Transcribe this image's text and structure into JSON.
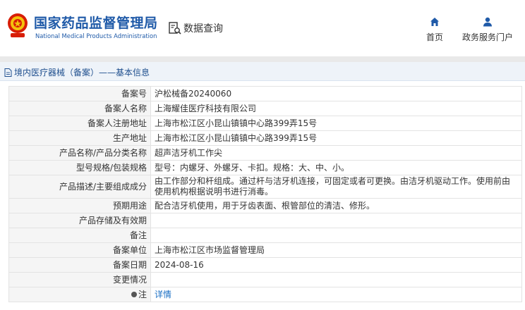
{
  "header": {
    "logo_cn": "国家药品监督管理局",
    "logo_en": "National Medical Products Administration",
    "query_label": "数据查询",
    "nav": [
      {
        "label": "首页",
        "icon": "home-icon"
      },
      {
        "label": "政务服务门户",
        "icon": "user-icon"
      }
    ]
  },
  "breadcrumb": "境内医疗器械（备案）——基本信息",
  "rows": [
    {
      "label": "备案号",
      "value": "沪松械备20240060"
    },
    {
      "label": "备案人名称",
      "value": "上海耀佳医疗科技有限公司"
    },
    {
      "label": "备案人注册地址",
      "value": "上海市松江区小昆山镇镇中心路399弄15号"
    },
    {
      "label": "生产地址",
      "value": "上海市松江区小昆山镇镇中心路399弄15号"
    },
    {
      "label": "产品名称/产品分类名称",
      "value": "超声洁牙机工作尖"
    },
    {
      "label": "型号规格/包装规格",
      "value": "型号：内螺牙、外螺牙、卡扣。规格：大、中、小。"
    },
    {
      "label": "产品描述/主要组成成分",
      "value": "由工作部分和杆组成。通过杆与洁牙机连接，可固定或者可更换。由洁牙机驱动工作。使用前由使用机构根据说明书进行消毒。"
    },
    {
      "label": "预期用途",
      "value": "配合洁牙机使用，用于牙齿表面、根管部位的清洁、修形。"
    },
    {
      "label": "产品存储及有效期",
      "value": ""
    },
    {
      "label": "备注",
      "value": ""
    },
    {
      "label": "备案单位",
      "value": "上海市松江区市场监督管理局"
    },
    {
      "label": "备案日期",
      "value": "2024-08-16"
    },
    {
      "label": "变更情况",
      "value": ""
    }
  ],
  "note": {
    "label": "注",
    "link_text": "详情"
  },
  "colors": {
    "brand_blue": "#1f5aa8",
    "link_blue": "#1a6fc4",
    "label_bg": "#f5f5f5"
  }
}
